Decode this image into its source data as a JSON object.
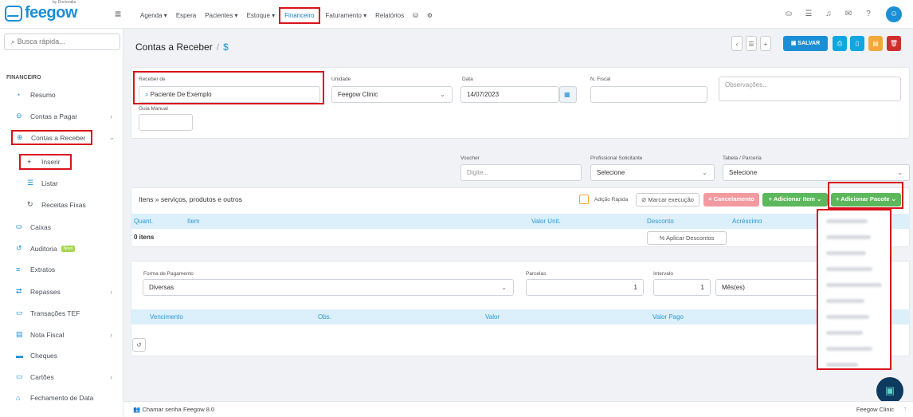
{
  "brand": {
    "name": "feegow",
    "sub": "by Doctoralia"
  },
  "nav": {
    "items": [
      "Agenda ▾",
      "Espera",
      "Pacientes ▾",
      "Estoque ▾",
      "Financeiro",
      "Faturamento ▾",
      "Relatórios"
    ],
    "active_index": 4
  },
  "sidebar": {
    "search_placeholder": "Busca rápida...",
    "section": "FINANCEIRO",
    "items": [
      {
        "label": "Resumo",
        "icon": "gauge-icon"
      },
      {
        "label": "Contas a Pagar",
        "icon": "minus-circle-icon",
        "chevron": true
      },
      {
        "label": "Contas a Receber",
        "icon": "plus-circle-icon",
        "chevron": true
      },
      {
        "label": "Inserir",
        "icon": "plus-icon"
      },
      {
        "label": "Listar",
        "icon": "list-icon"
      },
      {
        "label": "Receitas Fixas",
        "icon": "refresh-icon"
      },
      {
        "label": "Caixas",
        "icon": "cash-icon"
      },
      {
        "label": "Auditoria",
        "icon": "history-icon",
        "badge": "Novo"
      },
      {
        "label": "Extratos",
        "icon": "lines-icon"
      },
      {
        "label": "Repasses",
        "icon": "transfer-icon",
        "chevron": true
      },
      {
        "label": "Transações TEF",
        "icon": "card-icon"
      },
      {
        "label": "Nota Fiscal",
        "icon": "document-icon",
        "chevron": true
      },
      {
        "label": "Cheques",
        "icon": "cheque-icon"
      },
      {
        "label": "Cartões",
        "icon": "card-icon",
        "chevron": true
      },
      {
        "label": "Fechamento de Data",
        "icon": "lock-icon"
      }
    ]
  },
  "page": {
    "title": "Contas a Receber",
    "sep": "/",
    "currency": "$"
  },
  "toolbar": {
    "save": "SALVAR",
    "colors": {
      "blue": "#1b8fd6",
      "cyan": "#0fa7e0",
      "orange": "#f3a83b",
      "red": "#cf2e2e"
    }
  },
  "form": {
    "receber_de_label": "Receber de",
    "receber_de_value": "Paciente De Exemplo",
    "unidade_label": "Unidade",
    "unidade_value": "Feegow Clinic",
    "data_label": "Data",
    "data_value": "14/07/2023",
    "nfiscal_label": "N. Fiscal",
    "obs_placeholder": "Observações...",
    "guia_label": "Guia Manual",
    "voucher_label": "Voucher",
    "voucher_placeholder": "Digite...",
    "prof_label": "Profissional Solicitante",
    "prof_value": "Selecione",
    "tabela_label": "Tabela / Parceria",
    "tabela_value": "Selecione"
  },
  "items": {
    "title": "Itens » serviços, produtos e outros",
    "adicao_rapida": "Adição Rápida",
    "marcar": "Marcar execução",
    "cancelamento": "Cancelamento",
    "add_item": "+ Adicionar Item",
    "add_pacote": "+ Adicionar Pacote",
    "columns": [
      "Quant.",
      "Item",
      "Valor Unit.",
      "Desconto",
      "Acréscimo"
    ],
    "count": "0 itens",
    "aplicar": "Aplicar Descontos"
  },
  "payment": {
    "forma_label": "Forma de Pagamento",
    "forma_value": "Diversas",
    "parcelas_label": "Parcelas",
    "parcelas_value": "1",
    "intervalo_label": "Intervalo",
    "intervalo_value": "1",
    "periodo_value": "Mês(es)",
    "columns": [
      "Vencimento",
      "Obs.",
      "Valor",
      "Valor Pago"
    ]
  },
  "dropdown": {
    "item_count": 10
  },
  "footer": {
    "chamar": "Chamar senha",
    "version": "Feegow 8.0",
    "clinic": "Feegow Clinic"
  }
}
